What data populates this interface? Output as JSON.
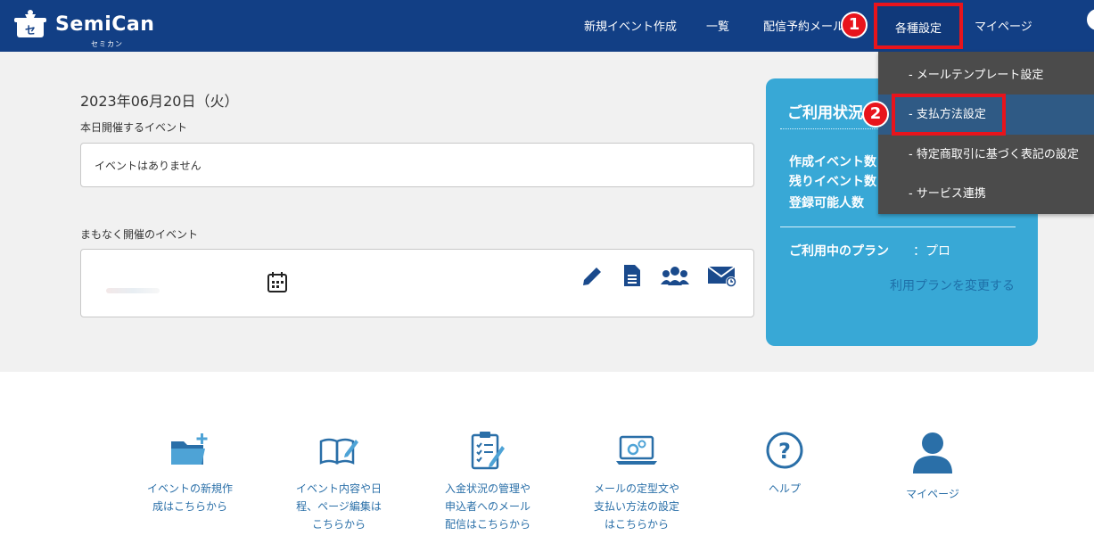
{
  "header": {
    "logo_text": "SemiCan",
    "logo_sub": "セミカン",
    "nav": {
      "new_event": "新規イベント作成",
      "list": "一覧",
      "scheduled_mail": "配信予約メール",
      "settings": "各種設定",
      "mypage": "マイページ"
    }
  },
  "badges": {
    "one": "1",
    "two": "2"
  },
  "dropdown": {
    "items": [
      {
        "label": "- メールテンプレート設定"
      },
      {
        "label": "- 支払方法設定"
      },
      {
        "label": "- 特定商取引に基づく表記の設定"
      },
      {
        "label": "- サービス連携"
      }
    ]
  },
  "main": {
    "date": "2023年06月20日（火）",
    "today_label": "本日開催するイベント",
    "today_empty": "イベントはありません",
    "upcoming_label": "まもなく開催のイベント"
  },
  "usage": {
    "title": "ご利用状況",
    "created_events": "作成イベント数",
    "remaining_events": "残りイベント数",
    "registrable": "登録可能人数",
    "plan_label": "ご利用中のプラン",
    "plan_value": "：プロ",
    "change_plan": "利用プランを変更する"
  },
  "tiles": [
    {
      "line1": "イベントの新規作",
      "line2": "成はこちらから",
      "line3": ""
    },
    {
      "line1": "イベント内容や日",
      "line2": "程、ページ編集は",
      "line3": "こちらから"
    },
    {
      "line1": "入金状況の管理や",
      "line2": "申込者へのメール",
      "line3": "配信はこちらから"
    },
    {
      "line1": "メールの定型文や",
      "line2": "支払い方法の設定",
      "line3": "はこちらから"
    },
    {
      "line1": "ヘルプ",
      "line2": "",
      "line3": ""
    },
    {
      "line1": "マイページ",
      "line2": "",
      "line3": ""
    }
  ],
  "colors": {
    "header": "#123f85",
    "accent_red": "#e8141c",
    "panel": "#38a8d6",
    "icon_blue": "#2a6fa8"
  }
}
